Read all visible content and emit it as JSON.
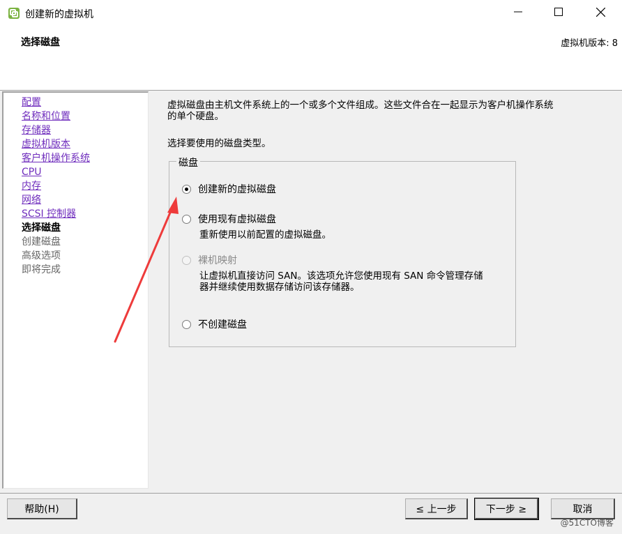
{
  "window": {
    "title": "创建新的虚拟机",
    "controls": {
      "minimize": "minimize-icon",
      "maximize": "maximize-icon",
      "close": "close-icon"
    }
  },
  "header": {
    "title": "选择磁盘",
    "version": "虚拟机版本: 8"
  },
  "sidebar": {
    "items": [
      {
        "label": "配置",
        "state": "link"
      },
      {
        "label": "名称和位置",
        "state": "link"
      },
      {
        "label": "存储器",
        "state": "link"
      },
      {
        "label": "虚拟机版本",
        "state": "link"
      },
      {
        "label": "客户机操作系统",
        "state": "link"
      },
      {
        "label": "CPU",
        "state": "link"
      },
      {
        "label": "内存",
        "state": "link"
      },
      {
        "label": "网络",
        "state": "link"
      },
      {
        "label": "SCSI 控制器",
        "state": "link"
      },
      {
        "label": "选择磁盘",
        "state": "current"
      },
      {
        "label": "创建磁盘",
        "state": "future"
      },
      {
        "label": "高级选项",
        "state": "future"
      },
      {
        "label": "即将完成",
        "state": "future"
      }
    ]
  },
  "main": {
    "description_line1": "虚拟磁盘由主机文件系统上的一个或多个文件组成。这些文件合在一起显示为客户机操作系统",
    "description_line2": "的单个硬盘。",
    "prompt": "选择要使用的磁盘类型。",
    "group_label": "磁盘",
    "options": [
      {
        "label": "创建新的虚拟磁盘",
        "checked": true,
        "enabled": true
      },
      {
        "label": "使用现有虚拟磁盘",
        "checked": false,
        "enabled": true,
        "desc": "重新使用以前配置的虚拟磁盘。"
      },
      {
        "label": "裸机映射",
        "checked": false,
        "enabled": false,
        "desc_line1": "让虚拟机直接访问 SAN。该选项允许您使用现有 SAN 命令管理存储",
        "desc_line2": "器并继续使用数据存储访问该存储器。"
      },
      {
        "label": "不创建磁盘",
        "checked": false,
        "enabled": true
      }
    ]
  },
  "buttons": {
    "help": "帮助(H)",
    "back": "≤ 上一步",
    "next": "下一步 ≥",
    "cancel": "取消"
  },
  "annotation_color": "#ee3b3b",
  "watermark": "@51CTO博客"
}
